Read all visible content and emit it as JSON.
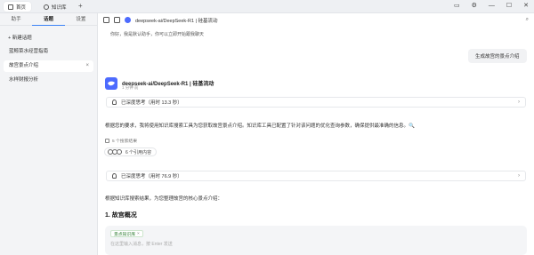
{
  "tabs": [
    {
      "label": "首页",
      "active": true
    },
    {
      "label": "知识库",
      "active": false
    }
  ],
  "sidebar": {
    "tabs": [
      "助手",
      "话题",
      "设置"
    ],
    "active_tab": 1,
    "new_topic": "+ 新建话题",
    "topics": [
      {
        "label": "蓝鲸菜水经营指南",
        "active": false
      },
      {
        "label": "故宫景点介绍",
        "active": true
      },
      {
        "label": "水样财报分析",
        "active": false
      }
    ]
  },
  "header": {
    "model": "deepseek-ai/DeepSeek-R1 | 硅基流动",
    "hint": "你好，我是默认助手，你可以立即开始跟我聊天"
  },
  "user_message": "生成故宫的景点介绍",
  "bot": {
    "name": "deepseek-ai/DeepSeek-R1 | 硅基流动",
    "time": "1 分钟 前"
  },
  "thinking1": "已深度思考（用时 13.3 秒）",
  "para1": "根据您的要求，我将使用知识库搜索工具为您获取故宫景点介绍。知识库工具已配置了针对该问题的优化查询参数，确保提供最准确的信息。🔍",
  "search_note": "5 个搜索结果",
  "refs_label": "6 个引用内容",
  "thinking2": "已深度思考（用时 76.9 秒）",
  "para2": "根据知识库搜索结果，为您整理故宫的核心景点介绍：",
  "heading": "1. 故宫概况",
  "input": {
    "kb_tag": "景点知识库",
    "placeholder": "在这里输入消息，按 Enter 发送"
  }
}
